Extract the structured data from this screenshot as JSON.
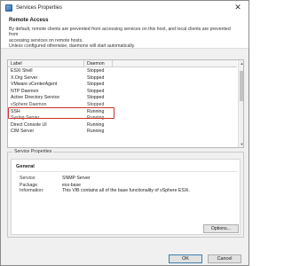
{
  "window": {
    "title": "Services Properties",
    "close_glyph": "✕"
  },
  "header": {
    "title": "Remote Access",
    "description_line1": "By default, remote clients are prevented from accessing services on this host, and local clients are prevented from",
    "description_line2": "accessing services on remote hosts.",
    "description_line3": "Unless configured otherwise, daemons will start automatically."
  },
  "services_table": {
    "columns": [
      "Label",
      "Daemon"
    ],
    "rows": [
      {
        "label": "ESXi Shell",
        "daemon": "Stopped"
      },
      {
        "label": "X.Org Server",
        "daemon": "Stopped"
      },
      {
        "label": "VMware vCenterAgent",
        "daemon": "Stopped"
      },
      {
        "label": "NTP Daemon",
        "daemon": "Stopped"
      },
      {
        "label": "Active Directory Service",
        "daemon": "Stopped"
      },
      {
        "label": "vSphere Daemon",
        "daemon": "Stopped"
      },
      {
        "label": "SSH",
        "daemon": "Running"
      },
      {
        "label": "Syslog Server",
        "daemon": "Running"
      },
      {
        "label": "Direct Console UI",
        "daemon": "Running"
      },
      {
        "label": "CIM Server",
        "daemon": "Running"
      }
    ],
    "highlighted_row": "SSH",
    "highlight_color": "#c8332d"
  },
  "service_properties": {
    "group_title": "Service Properties",
    "section_title": "General",
    "service_key": "Service:",
    "service_value": "SNMP Server",
    "package_key": "Package Information:",
    "package_value_line1": "esx-base",
    "package_value_line2": "This VIB contains all of the base functionality of vSphere ESXi.",
    "options_button": "Options..."
  },
  "footer": {
    "ok": "OK",
    "cancel": "Cancel"
  }
}
